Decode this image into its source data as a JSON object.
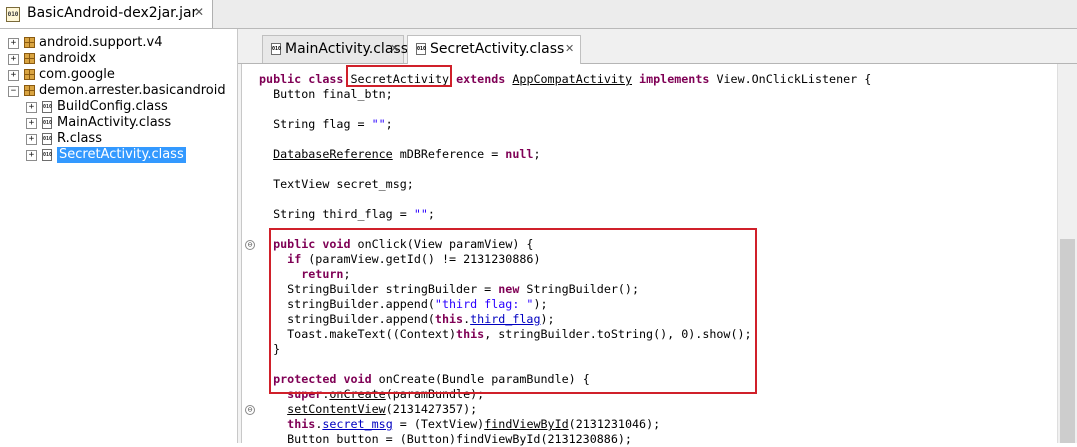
{
  "top_tab": {
    "icon": "010",
    "label": "BasicAndroid-dex2jar.jar",
    "close": "✕"
  },
  "tree": [
    {
      "expander": "+",
      "type": "package",
      "label": "android.support.v4"
    },
    {
      "expander": "+",
      "type": "package",
      "label": "androidx"
    },
    {
      "expander": "+",
      "type": "package",
      "label": "com.google"
    },
    {
      "expander": "−",
      "type": "package",
      "label": "demon.arrester.basicandroid"
    },
    {
      "expander": "+",
      "type": "class",
      "label": "BuildConfig.class"
    },
    {
      "expander": "+",
      "type": "class",
      "label": "MainActivity.class"
    },
    {
      "expander": "+",
      "type": "class",
      "label": "R.class"
    },
    {
      "expander": "+",
      "type": "class",
      "label": "SecretActivity.class",
      "selected": true
    }
  ],
  "editor_tabs": [
    {
      "icon": "010",
      "label": "MainActivity.class",
      "close": "✕",
      "active": false
    },
    {
      "icon": "010",
      "label": "SecretActivity.class",
      "close": "✕",
      "active": true
    }
  ],
  "fold_markers": [
    "⊖",
    "⊖"
  ],
  "code_lines": [
    [
      [
        "kw",
        "public"
      ],
      [
        "t",
        " "
      ],
      [
        "kw",
        "class"
      ],
      [
        "t",
        " SecretActivity "
      ],
      [
        "kw",
        "extends"
      ],
      [
        "t",
        " "
      ],
      [
        "u",
        "AppCompatActivity"
      ],
      [
        "t",
        " "
      ],
      [
        "kw",
        "implements"
      ],
      [
        "t",
        " View.OnClickListener {"
      ]
    ],
    [
      [
        "t",
        "  Button final_btn;"
      ]
    ],
    [],
    [
      [
        "t",
        "  String flag = "
      ],
      [
        "s",
        "\"\""
      ],
      [
        "t",
        ";"
      ]
    ],
    [],
    [
      [
        "t",
        "  "
      ],
      [
        "u",
        "DatabaseReference"
      ],
      [
        "t",
        " mDBReference = "
      ],
      [
        "kw",
        "null"
      ],
      [
        "t",
        ";"
      ]
    ],
    [],
    [
      [
        "t",
        "  TextView secret_msg;"
      ]
    ],
    [],
    [
      [
        "t",
        "  String third_flag = "
      ],
      [
        "s",
        "\"\""
      ],
      [
        "t",
        ";"
      ]
    ],
    [],
    [
      [
        "t",
        "  "
      ],
      [
        "kw",
        "public"
      ],
      [
        "t",
        " "
      ],
      [
        "kw",
        "void"
      ],
      [
        "t",
        " onClick(View paramView) {"
      ]
    ],
    [
      [
        "t",
        "    "
      ],
      [
        "kw",
        "if"
      ],
      [
        "t",
        " (paramView.getId() != 2131230886)"
      ]
    ],
    [
      [
        "t",
        "      "
      ],
      [
        "kw",
        "return"
      ],
      [
        "t",
        ";"
      ]
    ],
    [
      [
        "t",
        "    StringBuilder stringBuilder = "
      ],
      [
        "kw",
        "new"
      ],
      [
        "t",
        " StringBuilder();"
      ]
    ],
    [
      [
        "t",
        "    stringBuilder.append("
      ],
      [
        "s",
        "\"third flag: \""
      ],
      [
        "t",
        ");"
      ]
    ],
    [
      [
        "t",
        "    stringBuilder.append("
      ],
      [
        "kw",
        "this"
      ],
      [
        "t",
        "."
      ],
      [
        "fu",
        "third_flag"
      ],
      [
        "t",
        ");"
      ]
    ],
    [
      [
        "t",
        "    Toast.makeText((Context)"
      ],
      [
        "kw",
        "this"
      ],
      [
        "t",
        ", stringBuilder.toString(), 0).show();"
      ]
    ],
    [
      [
        "t",
        "  }"
      ]
    ],
    [],
    [
      [
        "t",
        "  "
      ],
      [
        "kw",
        "protected"
      ],
      [
        "t",
        " "
      ],
      [
        "kw",
        "void"
      ],
      [
        "t",
        " onCreate(Bundle paramBundle) {"
      ]
    ],
    [
      [
        "t",
        "    "
      ],
      [
        "kw",
        "super"
      ],
      [
        "t",
        "."
      ],
      [
        "u",
        "onCreate"
      ],
      [
        "t",
        "(paramBundle);"
      ]
    ],
    [
      [
        "t",
        "    "
      ],
      [
        "u",
        "setContentView"
      ],
      [
        "t",
        "(2131427357);"
      ]
    ],
    [
      [
        "t",
        "    "
      ],
      [
        "kw",
        "this"
      ],
      [
        "t",
        "."
      ],
      [
        "fu",
        "secret_msg"
      ],
      [
        "t",
        " = (TextView)"
      ],
      [
        "u",
        "findViewById"
      ],
      [
        "t",
        "(2131231046);"
      ]
    ],
    [
      [
        "t",
        "    Button button = (Button)findViewById(2131230886);"
      ]
    ]
  ]
}
